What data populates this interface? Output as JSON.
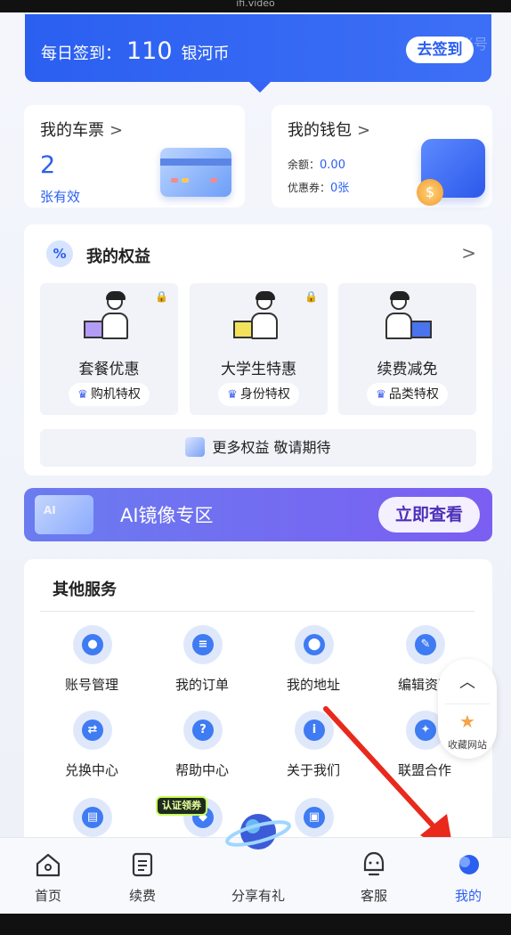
{
  "status_bar": {
    "url": "ifi.video"
  },
  "checkin": {
    "label": "每日签到：",
    "amount": "110",
    "unit": "银河币",
    "button": "去签到",
    "ghost_text": "绑定账号"
  },
  "ticket": {
    "title": "我的车票",
    "chevron": ">",
    "count": "2",
    "status": "张有效"
  },
  "wallet": {
    "title": "我的钱包",
    "chevron": ">",
    "balance_label": "余额：",
    "balance": "0.00",
    "coupon_label": "优惠券：",
    "coupon": "0张"
  },
  "benefits": {
    "icon": "%",
    "title": "我的权益",
    "chevron": ">",
    "items": [
      {
        "name": "套餐优惠",
        "tag": "购机特权",
        "locked": true
      },
      {
        "name": "大学生特惠",
        "tag": "身份特权",
        "locked": true
      },
      {
        "name": "续费减免",
        "tag": "品类特权",
        "locked": false
      }
    ],
    "more": "更多权益 敬请期待"
  },
  "ai_banner": {
    "badge": "AI",
    "label": "AI镜像专区",
    "button": "立即查看"
  },
  "services": {
    "title": "其他服务",
    "items": [
      {
        "label": "账号管理",
        "icon": "user-icon",
        "glyph": "●"
      },
      {
        "label": "我的订单",
        "icon": "clipboard-icon",
        "glyph": "≡"
      },
      {
        "label": "我的地址",
        "icon": "location-pin-icon",
        "glyph": "⬤"
      },
      {
        "label": "编辑资料",
        "icon": "edit-document-icon",
        "glyph": "✎"
      },
      {
        "label": "兑换中心",
        "icon": "exchange-icon",
        "glyph": "⇄"
      },
      {
        "label": "帮助中心",
        "icon": "help-icon",
        "glyph": "?"
      },
      {
        "label": "关于我们",
        "icon": "info-icon",
        "glyph": "i"
      },
      {
        "label": "联盟合作",
        "icon": "handshake-icon",
        "glyph": "✦"
      },
      {
        "label": "",
        "icon": "id-card-icon",
        "glyph": "▤"
      },
      {
        "label": "",
        "icon": "shield-icon",
        "glyph": "◆"
      },
      {
        "label": "",
        "icon": "box-icon",
        "glyph": "▣"
      }
    ],
    "badge": "认证领券"
  },
  "float_menu": {
    "up": "︿",
    "star": "★",
    "label": "收藏网站"
  },
  "tabs": [
    {
      "label": "首页",
      "icon": "home-icon",
      "active": false
    },
    {
      "label": "续费",
      "icon": "renew-icon",
      "active": false
    },
    {
      "label": "分享有礼",
      "icon": "planet-icon",
      "active": false
    },
    {
      "label": "客服",
      "icon": "support-icon",
      "active": false
    },
    {
      "label": "我的",
      "icon": "profile-icon",
      "active": true
    }
  ],
  "colors": {
    "primary": "#2b5ff0",
    "annotation_arrow": "#e8291c"
  }
}
